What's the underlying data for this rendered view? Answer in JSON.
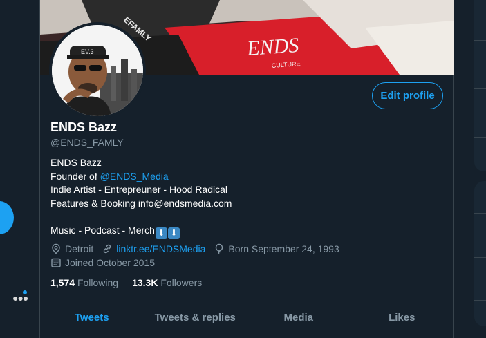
{
  "profile": {
    "display_name": "ENDS Bazz",
    "handle": "@ENDS_FAMLY",
    "edit_profile_label": "Edit profile"
  },
  "bio": {
    "line1": "ENDS Bazz",
    "line2_prefix": "Founder of ",
    "line2_mention": "@ENDS_Media",
    "line3": "Indie Artist - Entrepreuner - Hood Radical",
    "line4": "Features & Booking info@endsmedia.com",
    "line5": "Music - Podcast - Merch",
    "emoji_1": "⬇",
    "emoji_2": "⬇"
  },
  "meta": {
    "location": "Detroit",
    "website": "linktr.ee/ENDSMedia",
    "born": "Born September 24, 1993",
    "joined": "Joined October 2015"
  },
  "stats": {
    "following_count": "1,574",
    "following_label": "Following",
    "followers_count": "13.3K",
    "followers_label": "Followers"
  },
  "tabs": [
    {
      "label": "Tweets",
      "active": true
    },
    {
      "label": "Tweets & replies",
      "active": false
    },
    {
      "label": "Media",
      "active": false
    },
    {
      "label": "Likes",
      "active": false
    }
  ],
  "colors": {
    "background": "#15202b",
    "accent": "#1da1f2",
    "muted": "#8899a6",
    "border": "#38444d"
  },
  "icons": {
    "location": "location-pin-icon",
    "website": "link-icon",
    "born": "balloon-icon",
    "joined": "calendar-icon",
    "more": "more-dots-icon"
  }
}
